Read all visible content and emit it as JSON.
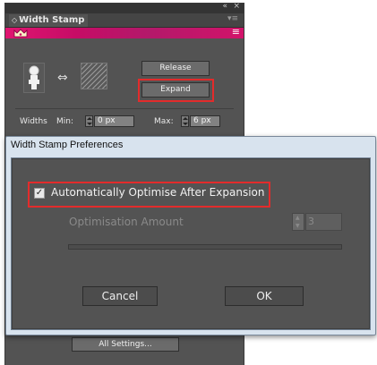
{
  "panel": {
    "collapse_glyph": "«",
    "close_glyph": "×",
    "tab_label": "Width Stamp",
    "tab_menu_icon": "▾≡",
    "brand_menu_icon": "≡",
    "brand_color": "#d8136b",
    "release_label": "Release",
    "expand_label": "Expand",
    "link_icon": "⇔",
    "widths_label": "Widths",
    "min_label": "Min:",
    "min_value": "0 px",
    "max_label": "Max:",
    "max_value": "6 px",
    "all_settings_label": "All Settings..."
  },
  "dialog": {
    "title": "Width Stamp Preferences",
    "auto_optimise_label": "Automatically Optimise After Expansion",
    "auto_optimise_checked": true,
    "check_glyph": "✓",
    "optimisation_amount_label": "Optimisation Amount",
    "optimisation_amount_value": "3",
    "cancel_label": "Cancel",
    "ok_label": "OK"
  },
  "highlight_color": "#e32b2b"
}
